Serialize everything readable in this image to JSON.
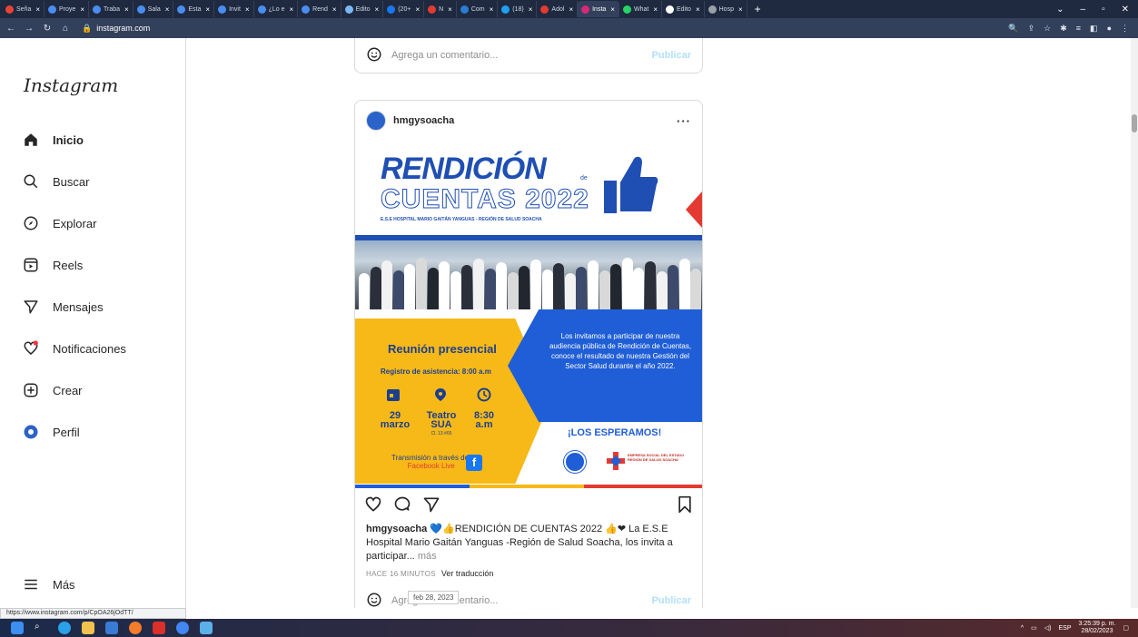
{
  "browser": {
    "tabs": [
      {
        "label": "Seña",
        "color": "#ea4335"
      },
      {
        "label": "Proye",
        "color": "#4a8df0"
      },
      {
        "label": "Traba",
        "color": "#4a8df0"
      },
      {
        "label": "Sala",
        "color": "#4a8df0"
      },
      {
        "label": "Esta",
        "color": "#4a8df0"
      },
      {
        "label": "Invit",
        "color": "#4a8df0"
      },
      {
        "label": "¿Lo e",
        "color": "#4a8df0"
      },
      {
        "label": "Rend",
        "color": "#4a8df0"
      },
      {
        "label": "Edito",
        "color": "#7ab8f5"
      },
      {
        "label": "(20+",
        "color": "#1877f2"
      },
      {
        "label": "N",
        "color": "#e43a31"
      },
      {
        "label": "Com",
        "color": "#2b7cd3"
      },
      {
        "label": "(18)",
        "color": "#1da1f2"
      },
      {
        "label": "Adol",
        "color": "#e43a31"
      },
      {
        "label": "Insta",
        "color": "#d62976",
        "active": true
      },
      {
        "label": "What",
        "color": "#25d366"
      },
      {
        "label": "Edito",
        "color": "#ffffff"
      },
      {
        "label": "Hosp",
        "color": "#9aa0a6"
      }
    ],
    "new_tab": "+",
    "url": "instagram.com"
  },
  "sidebar": {
    "logo": "Instagram",
    "items": [
      {
        "label": "Inicio",
        "icon": "home-icon"
      },
      {
        "label": "Buscar",
        "icon": "search-icon"
      },
      {
        "label": "Explorar",
        "icon": "compass-icon"
      },
      {
        "label": "Reels",
        "icon": "reels-icon"
      },
      {
        "label": "Mensajes",
        "icon": "send-icon"
      },
      {
        "label": "Notificaciones",
        "icon": "heart-icon"
      },
      {
        "label": "Crear",
        "icon": "plus-square-icon"
      },
      {
        "label": "Perfil",
        "icon": "profile-avatar-icon"
      }
    ],
    "more": "Más"
  },
  "feed": {
    "top_comment": {
      "placeholder": "Agrega un comentario...",
      "publish": "Publicar"
    },
    "post": {
      "username": "hmgysoacha",
      "more": "···",
      "poster": {
        "title1": "RENDICIÓN",
        "de": "de",
        "title2": "CUENTAS 2022",
        "subtitle": "E.S.E HOSPITAL MARIO GAITÁN YANGUAS - REGIÓN DE SALUD SOACHA",
        "meeting": "Reunión presencial",
        "registration": "Registro de asistencia: 8:00 a.m",
        "date_day": "29",
        "date_month": "marzo",
        "place": "Teatro SUA",
        "place_sub": "Cl. 13 #65",
        "time": "8:30",
        "time_unit": "a.m",
        "transmission": "Transmisión a través de:",
        "transmission_link": "Facebook Live",
        "invite": "Los invitamos a participar de nuestra audiencia pública de Rendición de Cuentas, conoce el resultado de nuestra Gestión del Sector Salud durante el año 2022.",
        "esperamos": "¡LOS ESPERAMOS!",
        "region_logo_text": "EMPRESA SOCIAL DEL ESTADO REGIÓN DE SALUD SOACHA"
      },
      "caption_user": "hmgysoacha",
      "caption_text": " 💙👍RENDICIÓN DE CUENTAS 2022 👍❤ La E.S.E Hospital Mario Gaitán Yanguas -Región de Salud Soacha, los invita a participar...",
      "caption_more": "más",
      "time_ago": "HACE 16 MINUTOS",
      "translate": "Ver traducción",
      "comment_placeholder": "Agrega un comentario...",
      "publish": "Publicar"
    },
    "tooltip": "feb 28, 2023"
  },
  "status_url": "https://www.instagram.com/p/CpOA26jOdTT/",
  "taskbar": {
    "lang": "ESP",
    "time": "3:25:39 p. m.",
    "date": "28/02/2023"
  }
}
